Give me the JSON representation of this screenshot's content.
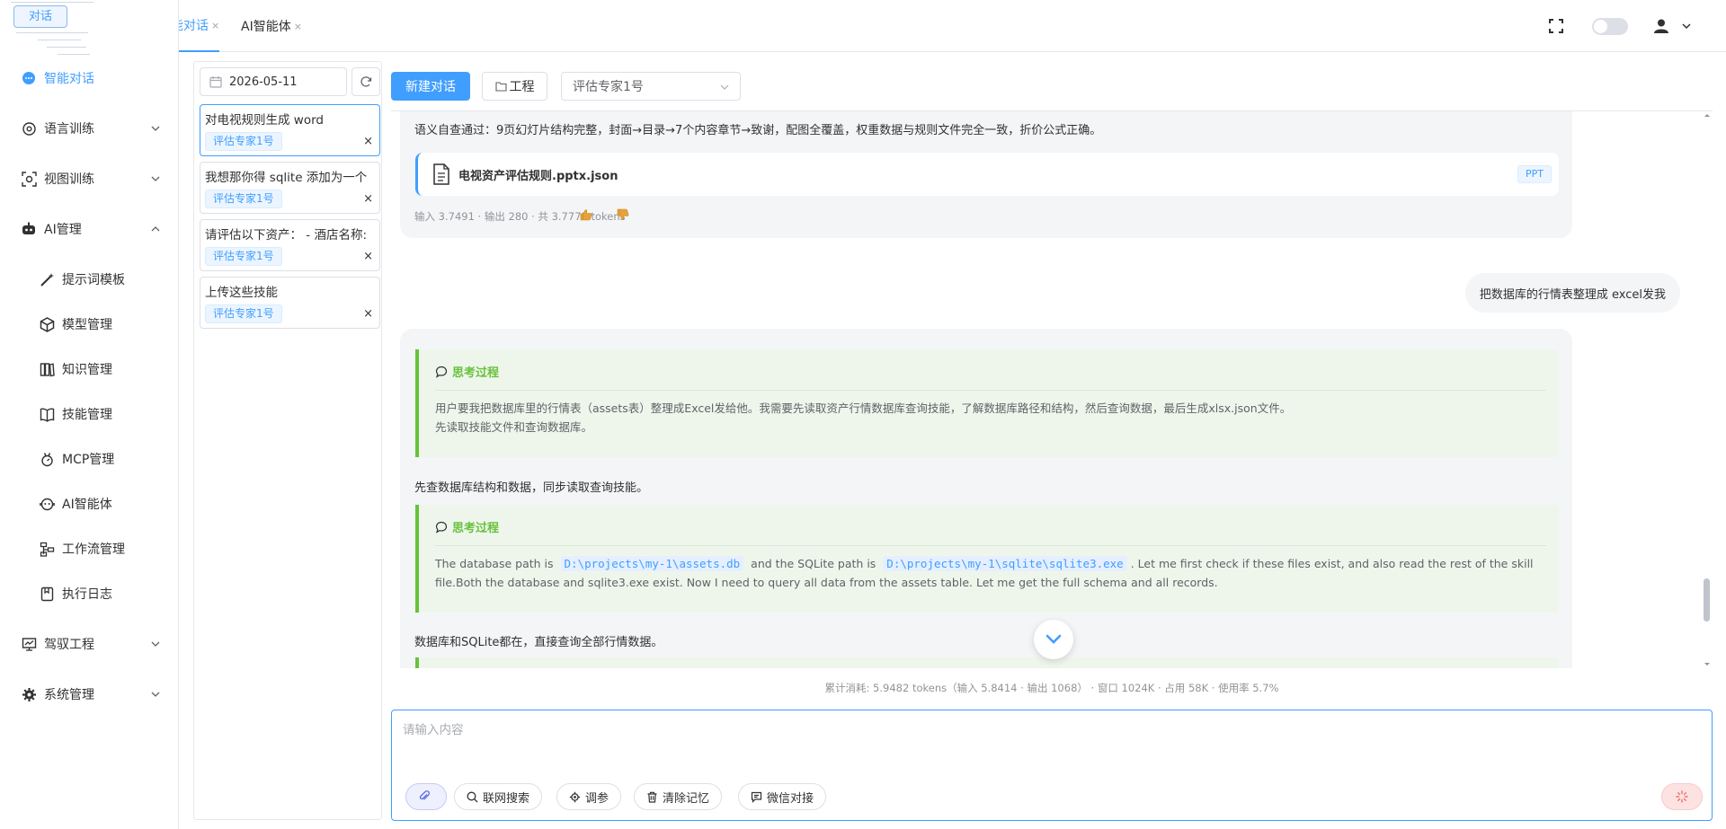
{
  "brand": {
    "logo_text": "对话"
  },
  "header": {
    "tabs": [
      {
        "label": "智能对话",
        "close": "×"
      },
      {
        "label": "AI智能体",
        "close": "×"
      }
    ]
  },
  "sidebar": {
    "items": [
      {
        "label": "智能对话",
        "icon": "chat-bubble-icon",
        "active": true
      },
      {
        "label": "语言训练",
        "icon": "brain-icon",
        "expandable": true
      },
      {
        "label": "视图训练",
        "icon": "face-scan-icon",
        "expandable": true
      },
      {
        "label": "AI管理",
        "icon": "robot-icon",
        "expandable": true,
        "expanded": true
      },
      {
        "label": "提示词模板",
        "icon": "magic-wand-icon"
      },
      {
        "label": "模型管理",
        "icon": "cube-icon"
      },
      {
        "label": "知识管理",
        "icon": "book-icon"
      },
      {
        "label": "技能管理",
        "icon": "book-open-icon"
      },
      {
        "label": "MCP管理",
        "icon": "plug-icon"
      },
      {
        "label": "AI智能体",
        "icon": "bot-face-icon"
      },
      {
        "label": "工作流管理",
        "icon": "workflow-icon"
      },
      {
        "label": "执行日志",
        "icon": "log-icon"
      },
      {
        "label": "驾驭工程",
        "icon": "dashboard-icon",
        "expandable": true
      },
      {
        "label": "系统管理",
        "icon": "gear-icon",
        "expandable": true
      }
    ]
  },
  "history": {
    "date": "2026-05-11",
    "conversations": [
      {
        "title": "对电视规则生成 word",
        "tag": "评估专家1号",
        "delete": "×"
      },
      {
        "title": "我想那你得 sqlite 添加为一个",
        "tag": "评估专家1号",
        "delete": "×"
      },
      {
        "title": "请评估以下资产： - 酒店名称:",
        "tag": "评估专家1号",
        "delete": "×"
      },
      {
        "title": "上传这些技能",
        "tag": "评估专家1号",
        "delete": "×"
      }
    ]
  },
  "toolbar": {
    "new_chat": "新建对话",
    "project": "工程",
    "expert_selected": "评估专家1号"
  },
  "messages": {
    "ai1": {
      "text": "语义自查通过：9页幻灯片结构完整，封面→目录→7个内容章节→致谢，配图全覆盖，权重数据与规则文件完全一致，折价公式正确。",
      "file_name": "电视资产评估规则.pptx.json",
      "file_tag": "PPT",
      "meta": "输入 3.7491 · 输出 280 · 共 3.7771 tokens"
    },
    "user1": "把数据库的行情表整理成 excel发我",
    "ai2": {
      "think1_title": "思考过程",
      "think1_line1": "用户要我把数据库里的行情表（assets表）整理成Excel发给他。我需要先读取资产行情数据库查询技能，了解数据库路径和结构，然后查询数据，最后生成xlsx.json文件。",
      "think1_line2": "先读取技能文件和查询数据库。",
      "text1": "先查数据库结构和数据，同步读取查询技能。",
      "think2_title": "思考过程",
      "think2_a": "The database path is",
      "think2_code1": "D:\\projects\\my-1\\assets.db",
      "think2_b": "and the SQLite path is",
      "think2_code2": "D:\\projects\\my-1\\sqlite\\sqlite3.exe",
      "think2_c": ". Let me first check if these files exist, and also read the rest of the skill",
      "think2_line2": "file.Both the database and sqlite3.exe exist. Now I need to query all data from the assets table. Let me get the full schema and all records.",
      "text2": "数据库和SQLite都在，直接查询全部行情数据。"
    }
  },
  "usage": "累计消耗: 5.9482 tokens（输入 5.8414 · 输出 1068） · 窗口 1024K · 占用 58K · 使用率 5.7%",
  "composer": {
    "placeholder": "请输入内容",
    "web_search": "联网搜索",
    "params": "调参",
    "clear_memory": "清除记忆",
    "wechat": "微信对接"
  },
  "colors": {
    "primary": "#409eff",
    "think_border": "#67c23a",
    "think_bg": "#eef6ec"
  }
}
